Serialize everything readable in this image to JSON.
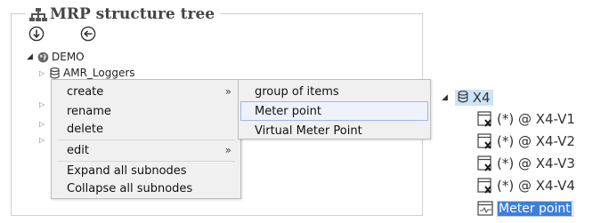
{
  "panel": {
    "title": "MRP structure tree"
  },
  "tree": {
    "root": "DEMO",
    "child": "AMR_Loggers"
  },
  "context_menu": {
    "items": [
      {
        "label": "create",
        "submenu": true
      },
      {
        "label": "rename",
        "submenu": false
      },
      {
        "label": "delete",
        "submenu": false
      },
      {
        "label": "edit",
        "submenu": true
      },
      {
        "label": "Expand all subnodes",
        "submenu": false
      },
      {
        "label": "Collapse all subnodes",
        "submenu": false
      }
    ],
    "arrow": "»"
  },
  "submenu": {
    "items": [
      {
        "label": "group of items"
      },
      {
        "label": "Meter point"
      },
      {
        "label": "Virtual Meter Point"
      }
    ],
    "highlighted_index": 1
  },
  "right_tree": {
    "node": "X4",
    "children": [
      {
        "label": "(*) @ X4-V1"
      },
      {
        "label": "(*) @ X4-V2"
      },
      {
        "label": "(*) @ X4-V3"
      },
      {
        "label": "(*) @ X4-V4"
      }
    ],
    "new_node_value": "Meter point"
  },
  "colors": {
    "selection": "#cde3f7",
    "edit_selection": "#3d7fd6",
    "menu_bg": "#f0f0f0"
  }
}
